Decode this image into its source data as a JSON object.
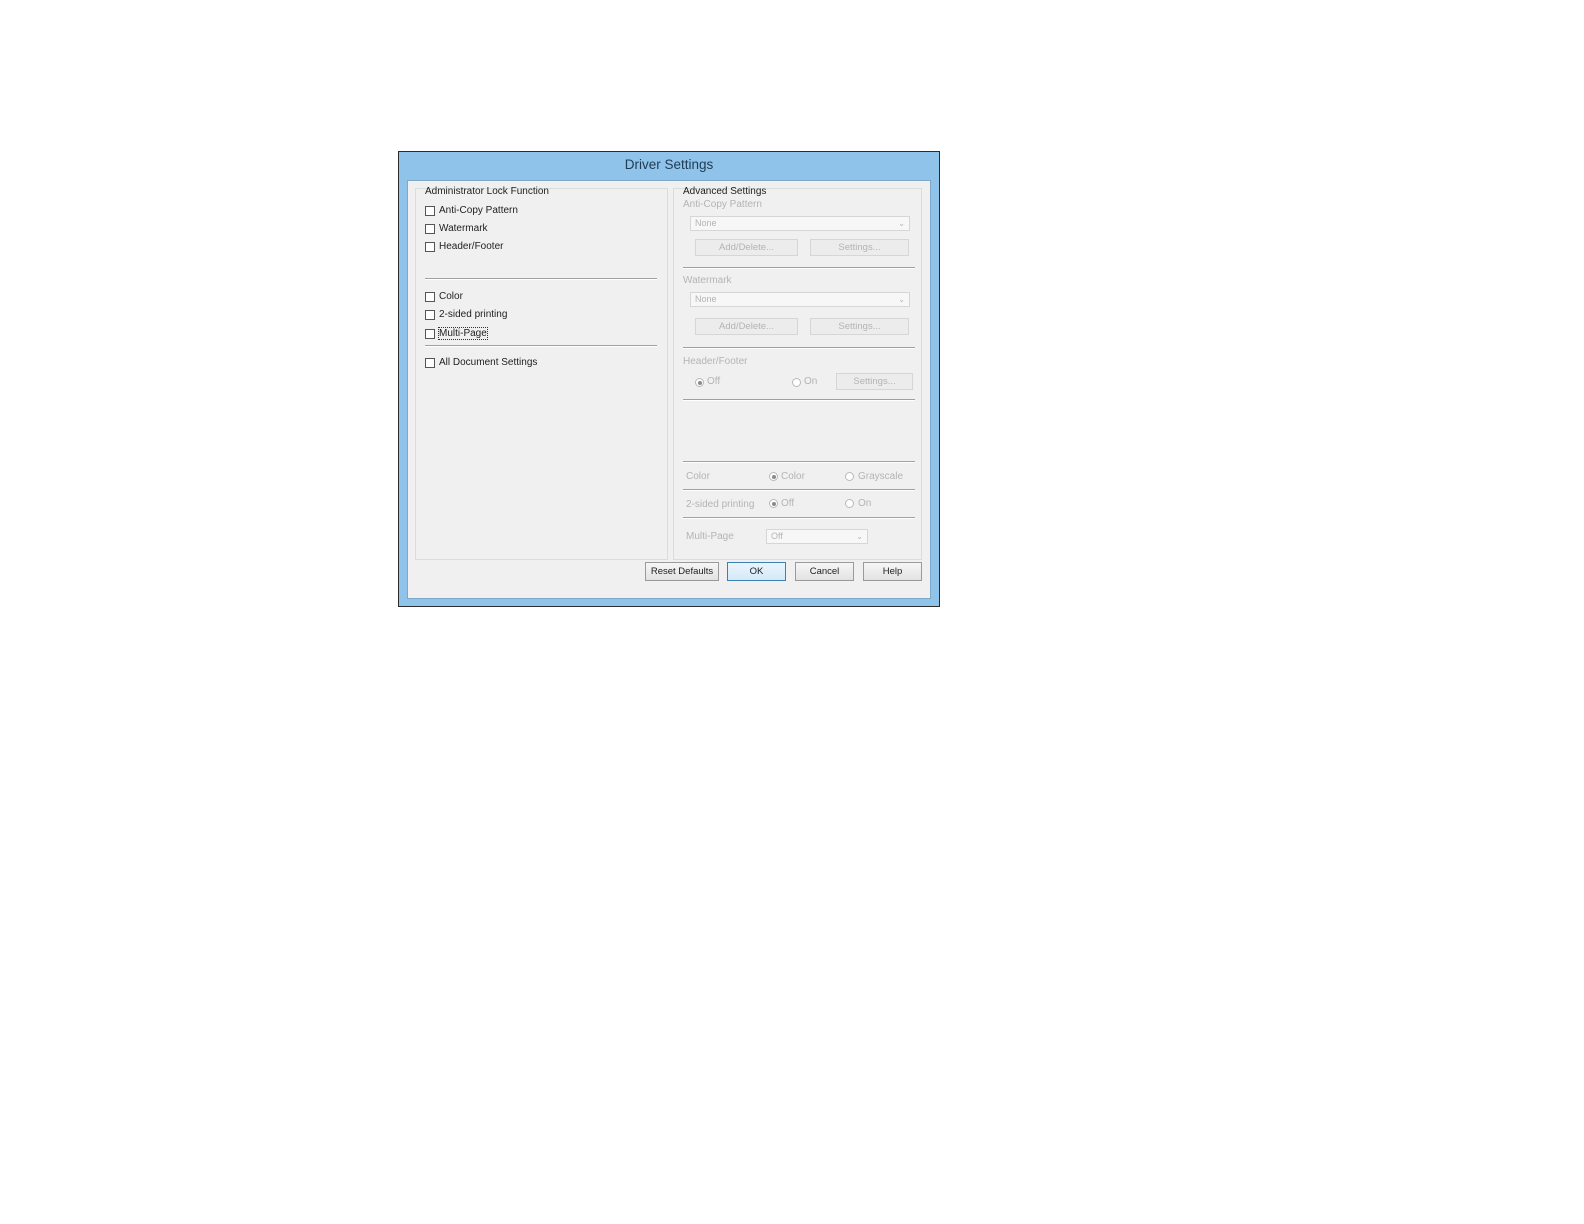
{
  "dialog": {
    "title": "Driver Settings"
  },
  "admin_lock": {
    "heading": "Administrator Lock Function",
    "items": [
      {
        "label": "Anti-Copy Pattern",
        "checked": false
      },
      {
        "label": "Watermark",
        "checked": false
      },
      {
        "label": "Header/Footer",
        "checked": false
      },
      {
        "label": "Color",
        "checked": false
      },
      {
        "label": "2-sided printing",
        "checked": false
      },
      {
        "label": "Multi-Page",
        "checked": false
      },
      {
        "label": "All Document Settings",
        "checked": false
      }
    ]
  },
  "advanced": {
    "heading": "Advanced Settings",
    "anti_copy": {
      "label": "Anti-Copy Pattern",
      "value": "None",
      "add_delete": "Add/Delete...",
      "settings": "Settings..."
    },
    "watermark": {
      "label": "Watermark",
      "value": "None",
      "add_delete": "Add/Delete...",
      "settings": "Settings..."
    },
    "header_footer": {
      "label": "Header/Footer",
      "off": "Off",
      "on": "On",
      "selected": "Off",
      "settings": "Settings..."
    },
    "color": {
      "label": "Color",
      "opt1": "Color",
      "opt2": "Grayscale",
      "selected": "Color"
    },
    "two_sided": {
      "label": "2-sided printing",
      "off": "Off",
      "on": "On",
      "selected": "Off"
    },
    "multi_page": {
      "label": "Multi-Page",
      "value": "Off"
    }
  },
  "buttons": {
    "reset": "Reset Defaults",
    "ok": "OK",
    "cancel": "Cancel",
    "help": "Help"
  }
}
